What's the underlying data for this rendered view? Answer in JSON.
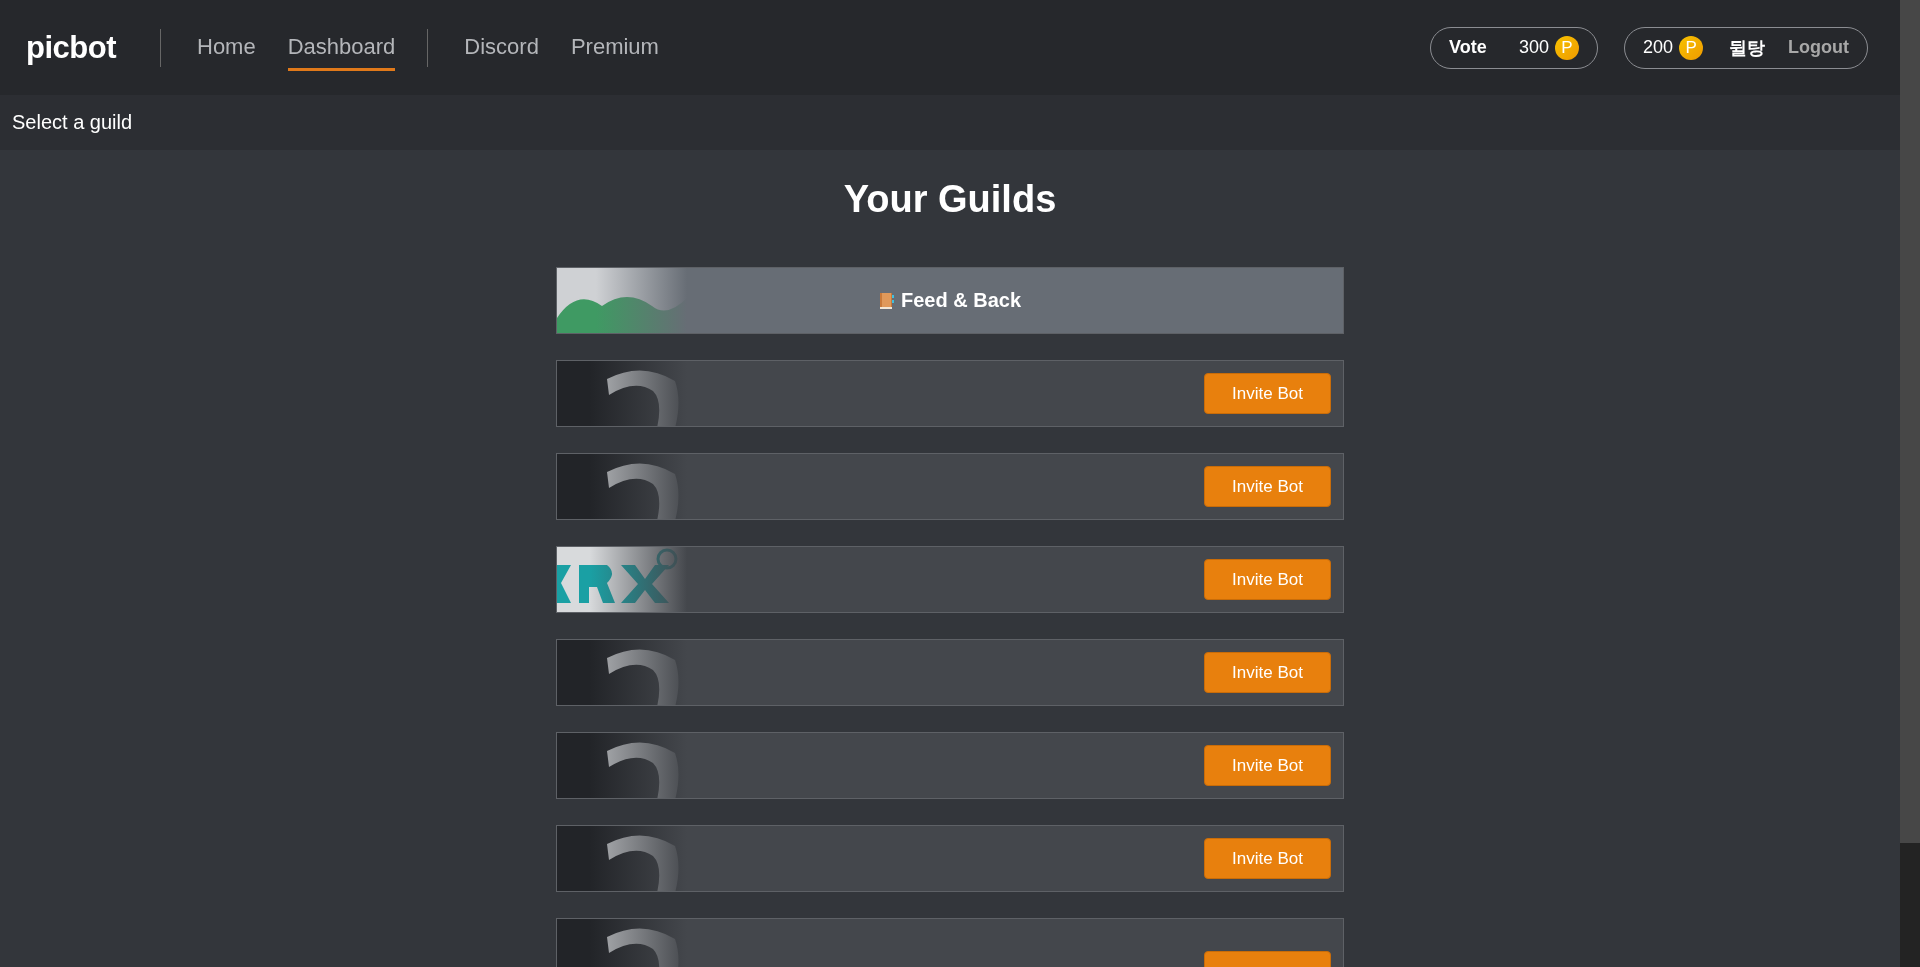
{
  "brand": "picbot",
  "nav_groups": [
    {
      "links": [
        {
          "label": "Home",
          "selected": false
        },
        {
          "label": "Dashboard",
          "selected": true
        }
      ]
    },
    {
      "links": [
        {
          "label": "Discord",
          "selected": false
        },
        {
          "label": "Premium",
          "selected": false
        }
      ]
    }
  ],
  "vote": {
    "label": "Vote",
    "points": "300",
    "coin": "P"
  },
  "user": {
    "points": "200",
    "coin": "P",
    "name": "뒬탕",
    "logout": "Logout"
  },
  "breadcrumb": "Select a guild",
  "title": "Your Guilds",
  "guilds": [
    {
      "kind": "named",
      "name": "Feed & Back"
    },
    {
      "kind": "invite",
      "button": "Invite Bot"
    },
    {
      "kind": "invite",
      "button": "Invite Bot"
    },
    {
      "kind": "invite",
      "button": "Invite Bot"
    },
    {
      "kind": "invite",
      "button": "Invite Bot"
    },
    {
      "kind": "invite",
      "button": "Invite Bot"
    },
    {
      "kind": "invite",
      "button": "Invite Bot"
    },
    {
      "kind": "invite"
    }
  ]
}
